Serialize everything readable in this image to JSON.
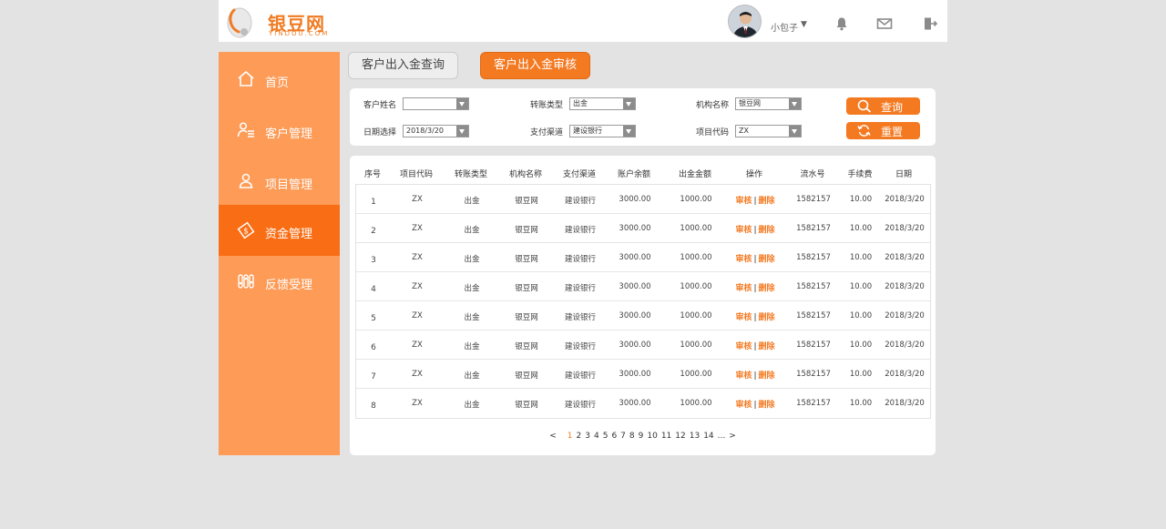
{
  "brand": {
    "name": "银豆网",
    "subtitle": "YINDOU.COM",
    "color": "#f07b22"
  },
  "header": {
    "username": "小包子",
    "user_caret": "▼",
    "icons": [
      "bell-icon",
      "mail-icon",
      "logout-icon"
    ]
  },
  "sidebar": {
    "bg": "#fd9b57",
    "active_bg": "#f96e15",
    "items": [
      {
        "label": "首页",
        "icon": "home-icon"
      },
      {
        "label": "客户管理",
        "icon": "customer-list-icon"
      },
      {
        "label": "项目管理",
        "icon": "user-icon"
      },
      {
        "label": "资金管理",
        "icon": "money-tag-icon",
        "active": true
      },
      {
        "label": "反馈受理",
        "icon": "feedback-icon"
      }
    ]
  },
  "tabs": {
    "query": "客户出入金查询",
    "audit": "客户出入金审核"
  },
  "filter": {
    "customer_name": {
      "label": "客户姓名",
      "value": ""
    },
    "transfer_type": {
      "label": "转账类型",
      "value": "出金"
    },
    "org_name": {
      "label": "机构名称",
      "value": "银豆网"
    },
    "date": {
      "label": "日期选择",
      "value": "2018/3/20"
    },
    "pay_channel": {
      "label": "支付渠道",
      "value": "建设银行"
    },
    "project_code": {
      "label": "项目代码",
      "value": "ZX"
    },
    "search_button": "查询",
    "reset_button": "重置"
  },
  "table": {
    "headers": [
      "序号",
      "项目代码",
      "转账类型",
      "机构名称",
      "支付渠道",
      "账户余额",
      "出金金额",
      "操作",
      "流水号",
      "手续费",
      "日期"
    ],
    "op_audit": "审核",
    "op_sep": "|",
    "op_delete": "删除",
    "rows": [
      {
        "idx": "1",
        "code": "ZX",
        "type": "出金",
        "org": "银豆网",
        "channel": "建设银行",
        "balance": "3000.00",
        "amount": "1000.00",
        "serial": "1582157",
        "fee": "10.00",
        "date": "2018/3/20"
      },
      {
        "idx": "2",
        "code": "ZX",
        "type": "出金",
        "org": "银豆网",
        "channel": "建设银行",
        "balance": "3000.00",
        "amount": "1000.00",
        "serial": "1582157",
        "fee": "10.00",
        "date": "2018/3/20"
      },
      {
        "idx": "3",
        "code": "ZX",
        "type": "出金",
        "org": "银豆网",
        "channel": "建设银行",
        "balance": "3000.00",
        "amount": "1000.00",
        "serial": "1582157",
        "fee": "10.00",
        "date": "2018/3/20"
      },
      {
        "idx": "4",
        "code": "ZX",
        "type": "出金",
        "org": "银豆网",
        "channel": "建设银行",
        "balance": "3000.00",
        "amount": "1000.00",
        "serial": "1582157",
        "fee": "10.00",
        "date": "2018/3/20"
      },
      {
        "idx": "5",
        "code": "ZX",
        "type": "出金",
        "org": "银豆网",
        "channel": "建设银行",
        "balance": "3000.00",
        "amount": "1000.00",
        "serial": "1582157",
        "fee": "10.00",
        "date": "2018/3/20"
      },
      {
        "idx": "6",
        "code": "ZX",
        "type": "出金",
        "org": "银豆网",
        "channel": "建设银行",
        "balance": "3000.00",
        "amount": "1000.00",
        "serial": "1582157",
        "fee": "10.00",
        "date": "2018/3/20"
      },
      {
        "idx": "7",
        "code": "ZX",
        "type": "出金",
        "org": "银豆网",
        "channel": "建设银行",
        "balance": "3000.00",
        "amount": "1000.00",
        "serial": "1582157",
        "fee": "10.00",
        "date": "2018/3/20"
      },
      {
        "idx": "8",
        "code": "ZX",
        "type": "出金",
        "org": "银豆网",
        "channel": "建设银行",
        "balance": "3000.00",
        "amount": "1000.00",
        "serial": "1582157",
        "fee": "10.00",
        "date": "2018/3/20"
      }
    ]
  },
  "pagination": {
    "prev": "<",
    "pages": [
      "1",
      "2",
      "3",
      "4",
      "5",
      "6",
      "7",
      "8",
      "9",
      "10",
      "11",
      "12",
      "13",
      "14"
    ],
    "current": "1",
    "ellipsis": "...",
    "next": ">"
  }
}
